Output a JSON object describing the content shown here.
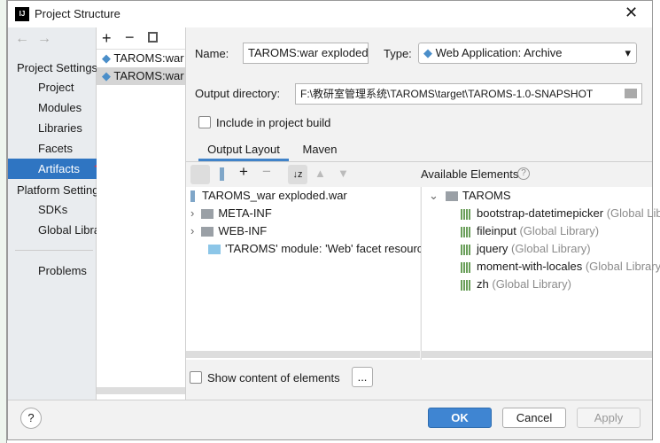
{
  "window": {
    "title": "Project Structure",
    "app_icon": "IJ"
  },
  "sidebar": {
    "project_settings_header": "Project Settings",
    "items": [
      {
        "label": "Project"
      },
      {
        "label": "Modules"
      },
      {
        "label": "Libraries"
      },
      {
        "label": "Facets"
      },
      {
        "label": "Artifacts",
        "selected": true
      }
    ],
    "platform_settings_header": "Platform Settings",
    "platform_items": [
      {
        "label": "SDKs"
      },
      {
        "label": "Global Libraries"
      }
    ],
    "problems": "Problems"
  },
  "artifacts_list": [
    "TAROMS:war",
    "TAROMS:war exploded"
  ],
  "form": {
    "name_label": "Name:",
    "name_value": "TAROMS:war exploded",
    "type_label": "Type:",
    "type_value": "Web Application: Archive",
    "output_label": "Output directory:",
    "output_value": "F:\\教研室管理系统\\TAROMS\\target\\TAROMS-1.0-SNAPSHOT",
    "include_label": "Include in project build",
    "include_checked": false
  },
  "tabs": [
    {
      "label": "Output Layout",
      "active": true
    },
    {
      "label": "Maven"
    }
  ],
  "layout_tree": {
    "root": "TAROMS_war exploded.war",
    "children": [
      "META-INF",
      "WEB-INF",
      "'TAROMS' module: 'Web' facet resources"
    ]
  },
  "available": {
    "header": "Available Elements",
    "root": "TAROMS",
    "libs": [
      {
        "name": "bootstrap-datetimepicker",
        "kind": "(Global Library)"
      },
      {
        "name": "fileinput",
        "kind": "(Global Library)"
      },
      {
        "name": "jquery",
        "kind": "(Global Library)"
      },
      {
        "name": "moment-with-locales",
        "kind": "(Global Library)"
      },
      {
        "name": "zh",
        "kind": "(Global Library)"
      }
    ]
  },
  "show_content_label": "Show content of elements",
  "ellipsis": "...",
  "buttons": {
    "help": "?",
    "ok": "OK",
    "cancel": "Cancel",
    "apply": "Apply"
  },
  "colors": {
    "accent": "#2f75c2",
    "arrow": "#e8323c"
  }
}
